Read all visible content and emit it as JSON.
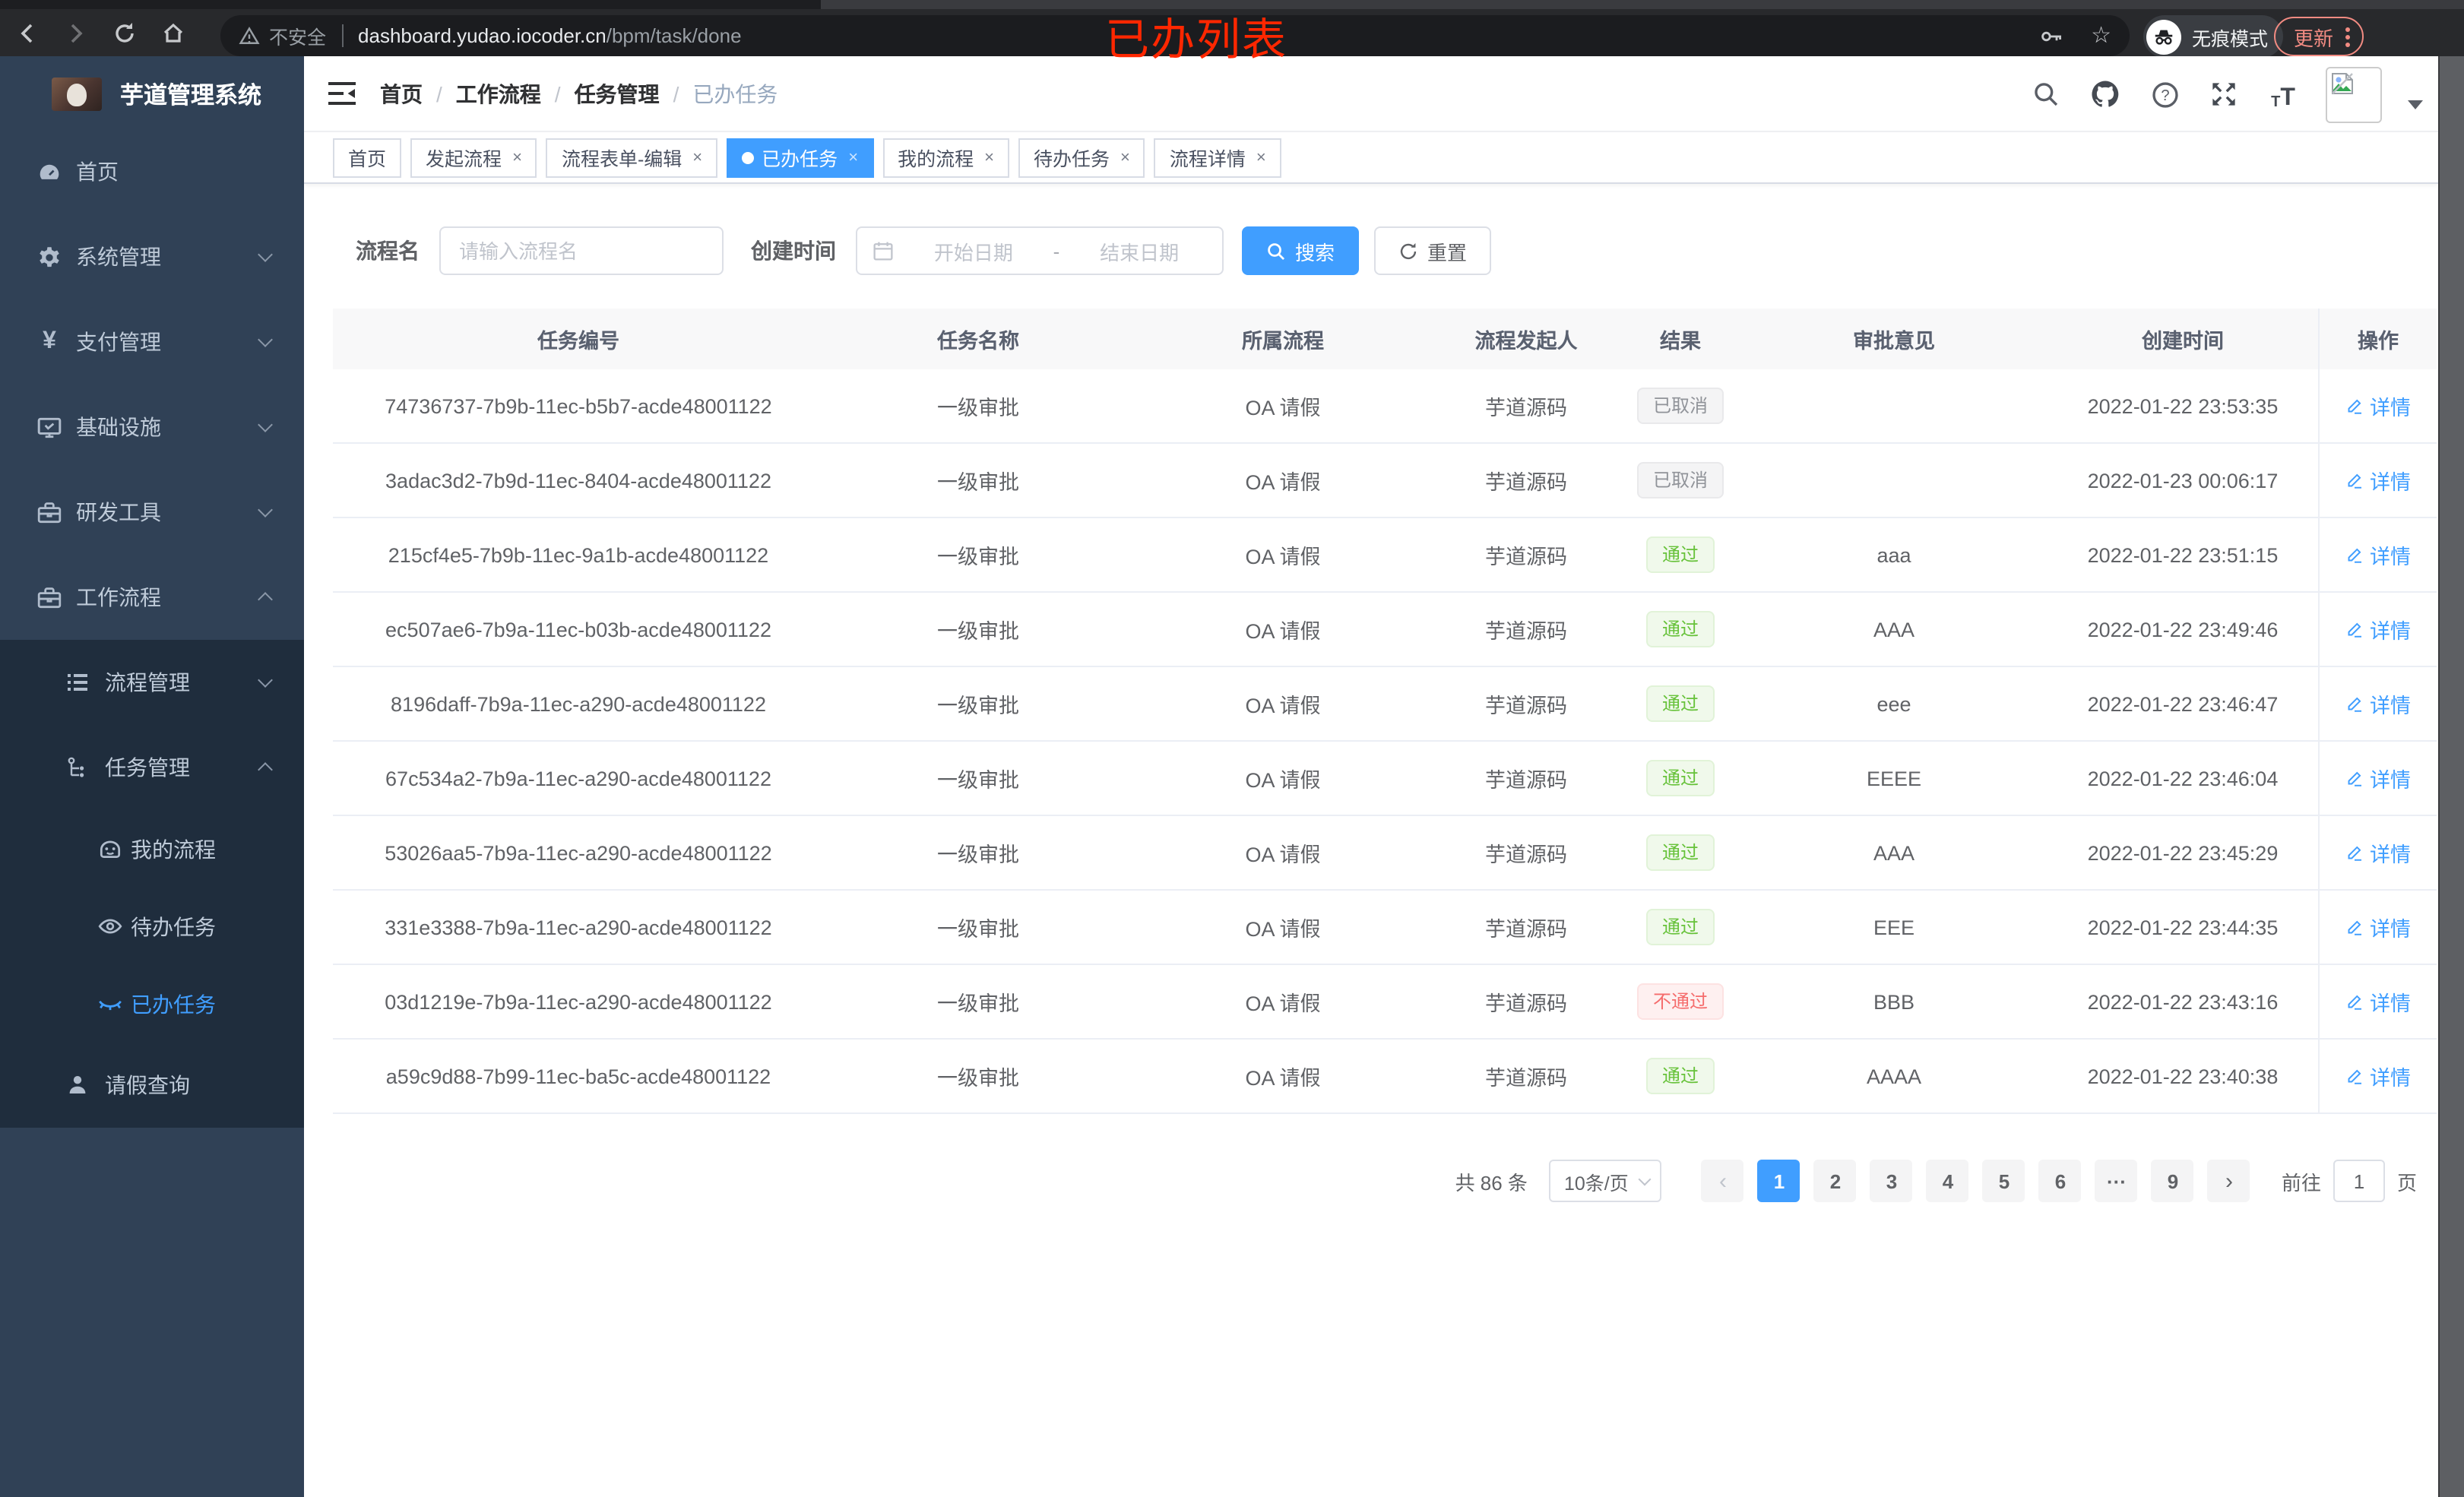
{
  "colors": {
    "accent": "#409eff",
    "success": "#67c23a",
    "danger": "#f56c6c",
    "info": "#909399",
    "annotation_red": "#ff2700",
    "update_salmon": "#f28b82",
    "sidebar_bg": "#304156",
    "submenu_bg": "#1f2d3d"
  },
  "browser": {
    "security_label": "不安全",
    "url_host": "dashboard.yudao.iocoder.cn",
    "url_path": "/bpm/task/done",
    "incognito_label": "无痕模式",
    "update_label": "更新"
  },
  "annotation": {
    "text": "已办列表"
  },
  "sidebar": {
    "app_title": "芋道管理系统",
    "items": [
      {
        "label": "首页"
      },
      {
        "label": "系统管理"
      },
      {
        "label": "支付管理"
      },
      {
        "label": "基础设施"
      },
      {
        "label": "研发工具"
      },
      {
        "label": "工作流程"
      }
    ],
    "workflow_children": {
      "process_mgmt": "流程管理",
      "task_mgmt": "任务管理",
      "my_process": "我的流程",
      "todo_task": "待办任务",
      "done_task": "已办任务",
      "leave_query": "请假查询"
    }
  },
  "breadcrumb": {
    "items": [
      "首页",
      "工作流程",
      "任务管理",
      "已办任务"
    ]
  },
  "tabs": [
    {
      "label": "首页",
      "closable": false
    },
    {
      "label": "发起流程",
      "closable": true
    },
    {
      "label": "流程表单-编辑",
      "closable": true
    },
    {
      "label": "已办任务",
      "closable": true,
      "active": true
    },
    {
      "label": "我的流程",
      "closable": true
    },
    {
      "label": "待办任务",
      "closable": true
    },
    {
      "label": "流程详情",
      "closable": true
    }
  ],
  "filter": {
    "name_label": "流程名",
    "name_placeholder": "请输入流程名",
    "time_label": "创建时间",
    "start_placeholder": "开始日期",
    "range_separator": "-",
    "end_placeholder": "结束日期",
    "search_label": "搜索",
    "reset_label": "重置"
  },
  "table": {
    "headers": [
      "任务编号",
      "任务名称",
      "所属流程",
      "流程发起人",
      "结果",
      "审批意见",
      "创建时间",
      "操作"
    ],
    "action_label": "详情",
    "rows": [
      {
        "id": "74736737-7b9b-11ec-b5b7-acde48001122",
        "name": "一级审批",
        "process": "OA 请假",
        "starter": "芋道源码",
        "result_text": "已取消",
        "result_type": "info",
        "comment": "",
        "time": "2022-01-22 23:53:35",
        "action": "详情"
      },
      {
        "id": "3adac3d2-7b9d-11ec-8404-acde48001122",
        "name": "一级审批",
        "process": "OA 请假",
        "starter": "芋道源码",
        "result_text": "已取消",
        "result_type": "info",
        "comment": "",
        "time": "2022-01-23 00:06:17",
        "action": "详情"
      },
      {
        "id": "215cf4e5-7b9b-11ec-9a1b-acde48001122",
        "name": "一级审批",
        "process": "OA 请假",
        "starter": "芋道源码",
        "result_text": "通过",
        "result_type": "success",
        "comment": "aaa",
        "time": "2022-01-22 23:51:15",
        "action": "详情"
      },
      {
        "id": "ec507ae6-7b9a-11ec-b03b-acde48001122",
        "name": "一级审批",
        "process": "OA 请假",
        "starter": "芋道源码",
        "result_text": "通过",
        "result_type": "success",
        "comment": "AAA",
        "time": "2022-01-22 23:49:46",
        "action": "详情"
      },
      {
        "id": "8196daff-7b9a-11ec-a290-acde48001122",
        "name": "一级审批",
        "process": "OA 请假",
        "starter": "芋道源码",
        "result_text": "通过",
        "result_type": "success",
        "comment": "eee",
        "time": "2022-01-22 23:46:47",
        "action": "详情"
      },
      {
        "id": "67c534a2-7b9a-11ec-a290-acde48001122",
        "name": "一级审批",
        "process": "OA 请假",
        "starter": "芋道源码",
        "result_text": "通过",
        "result_type": "success",
        "comment": "EEEE",
        "time": "2022-01-22 23:46:04",
        "action": "详情"
      },
      {
        "id": "53026aa5-7b9a-11ec-a290-acde48001122",
        "name": "一级审批",
        "process": "OA 请假",
        "starter": "芋道源码",
        "result_text": "通过",
        "result_type": "success",
        "comment": "AAA",
        "time": "2022-01-22 23:45:29",
        "action": "详情"
      },
      {
        "id": "331e3388-7b9a-11ec-a290-acde48001122",
        "name": "一级审批",
        "process": "OA 请假",
        "starter": "芋道源码",
        "result_text": "通过",
        "result_type": "success",
        "comment": "EEE",
        "time": "2022-01-22 23:44:35",
        "action": "详情"
      },
      {
        "id": "03d1219e-7b9a-11ec-a290-acde48001122",
        "name": "一级审批",
        "process": "OA 请假",
        "starter": "芋道源码",
        "result_text": "不通过",
        "result_type": "danger",
        "comment": "BBB",
        "time": "2022-01-22 23:43:16",
        "action": "详情"
      },
      {
        "id": "a59c9d88-7b99-11ec-ba5c-acde48001122",
        "name": "一级审批",
        "process": "OA 请假",
        "starter": "芋道源码",
        "result_text": "通过",
        "result_type": "success",
        "comment": "AAAA",
        "time": "2022-01-22 23:40:38",
        "action": "详情"
      }
    ]
  },
  "pagination": {
    "total": "共 86 条",
    "page_size": "10条/页",
    "prev": "‹",
    "next": "›",
    "pages": [
      {
        "label": "1",
        "active": true
      },
      {
        "label": "2"
      },
      {
        "label": "3"
      },
      {
        "label": "4"
      },
      {
        "label": "5"
      },
      {
        "label": "6"
      },
      {
        "label": "···"
      },
      {
        "label": "9"
      }
    ],
    "goto_label": "前往",
    "goto_value": "1",
    "page_unit": "页"
  }
}
